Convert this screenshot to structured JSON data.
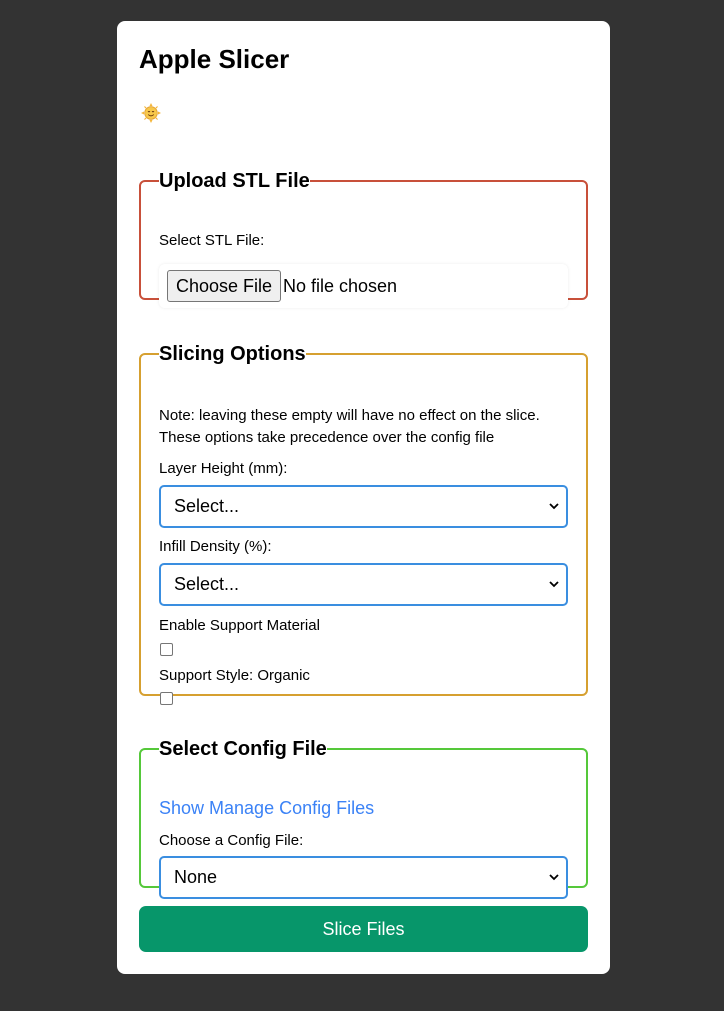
{
  "app": {
    "title": "Apple Slicer",
    "emoji_icon": "smiling-sun-icon"
  },
  "upload": {
    "legend": "Upload STL File",
    "file_label": "Select STL File:",
    "choose_button": "Choose File",
    "file_status": "No file chosen"
  },
  "slicing": {
    "legend": "Slicing Options",
    "note_line1": "Note: leaving these empty will have no effect on the slice.",
    "note_line2": "These options take precedence over the config file",
    "layer_height_label": "Layer Height (mm):",
    "layer_height_value": "Select...",
    "infill_label": "Infill Density (%):",
    "infill_value": "Select...",
    "support_label": "Enable Support Material",
    "support_checked": false,
    "organic_label": "Support Style: Organic",
    "organic_checked": false
  },
  "config": {
    "legend": "Select Config File",
    "manage_link": "Show Manage Config Files",
    "choose_label": "Choose a Config File:",
    "config_value": "None"
  },
  "actions": {
    "slice_button": "Slice Files"
  },
  "colors": {
    "background": "#333333",
    "upload_border": "#c8503a",
    "slicing_border": "#d6a030",
    "config_border": "#55c83a",
    "select_border": "#3a8ee0",
    "link": "#3b82f6",
    "slice_button": "#07966a"
  }
}
